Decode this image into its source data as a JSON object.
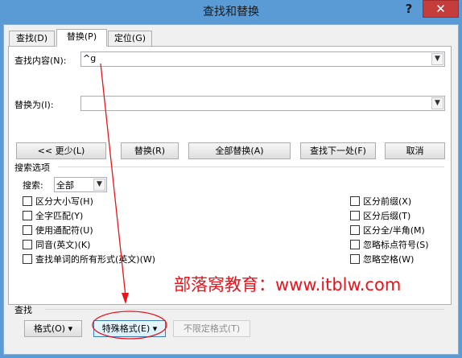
{
  "window": {
    "title": "查找和替换",
    "help": "?",
    "close": "✕"
  },
  "tabs": [
    {
      "label": "查找(D)"
    },
    {
      "label": "替换(P)"
    },
    {
      "label": "定位(G)"
    }
  ],
  "find": {
    "label": "查找内容(N):",
    "value": "^g"
  },
  "replace": {
    "label": "替换为(I):",
    "value": ""
  },
  "buttons": {
    "less": "<< 更少(L)",
    "replace": "替换(R)",
    "replace_all": "全部替换(A)",
    "find_next": "查找下一处(F)",
    "cancel": "取消"
  },
  "search_options": {
    "title": "搜索选项",
    "search_label": "搜索:",
    "search_value": "全部",
    "left_checks": [
      {
        "label": "区分大小写(H)",
        "checked": false
      },
      {
        "label": "全字匹配(Y)",
        "checked": false
      },
      {
        "label": "使用通配符(U)",
        "checked": false
      },
      {
        "label": "同音(英文)(K)",
        "checked": false
      },
      {
        "label": "查找单词的所有形式(英文)(W)",
        "checked": false
      }
    ],
    "right_checks": [
      {
        "label": "区分前缀(X)",
        "checked": false
      },
      {
        "label": "区分后缀(T)",
        "checked": false
      },
      {
        "label": "区分全/半角(M)",
        "checked": false
      },
      {
        "label": "忽略标点符号(S)",
        "checked": false
      },
      {
        "label": "忽略空格(W)",
        "checked": false
      }
    ]
  },
  "find_section": {
    "title": "查找",
    "format": "格式(O) ▾",
    "special": "特殊格式(E) ▾",
    "no_format": "不限定格式(T)"
  },
  "watermark": "部落窝教育：www.itblw.com",
  "colors": {
    "titlebar": "#5b9bd5",
    "close": "#c43c3c",
    "annotation": "#e8141c"
  }
}
